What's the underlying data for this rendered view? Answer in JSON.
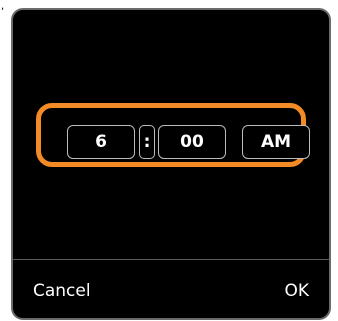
{
  "mark": ",",
  "picker": {
    "hour": "6",
    "separator": ":",
    "minute": "00",
    "period": "AM"
  },
  "actions": {
    "cancel_label": "Cancel",
    "ok_label": "OK"
  },
  "colors": {
    "focus_ring": "#f28a26",
    "dialog_bg": "#000000",
    "dialog_border": "#6b6b6b",
    "text": "#ffffff"
  }
}
